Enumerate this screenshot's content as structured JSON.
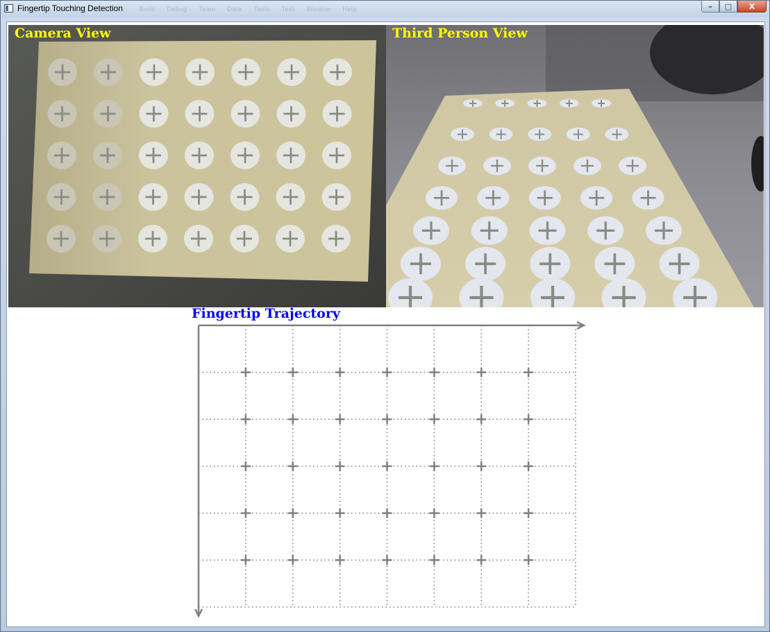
{
  "window": {
    "title": "Fingertip Touching Detection",
    "background_menu": [
      "Build",
      "Debug",
      "Team",
      "Data",
      "Tools",
      "Test",
      "Window",
      "Help"
    ],
    "controls": {
      "minimize": "–",
      "maximize": "□",
      "close": "X"
    }
  },
  "camera_view": {
    "label": "Camera View",
    "grid_rows": 5,
    "grid_cols": 7
  },
  "third_person_view": {
    "label": "Third Person View",
    "grid_rows": 7,
    "grid_cols": 5
  },
  "trajectory": {
    "title": "Fingertip Trajectory",
    "grid_rows": 5,
    "grid_cols": 7
  },
  "colors": {
    "view_label": "#ffff00",
    "trajectory_title": "#0000ff",
    "grid": "#808080",
    "paper": "#c8c09a"
  }
}
